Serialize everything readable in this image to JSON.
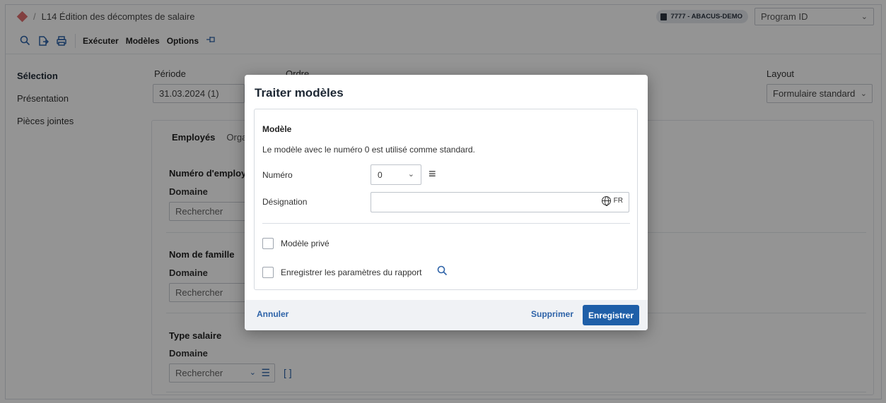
{
  "titlebar": {
    "breadcrumb_separator": "/",
    "title": "L14 Édition des décomptes de salaire",
    "environment": "7777 - ABACUS-DEMO",
    "program_select": "Program ID"
  },
  "toolbar": {
    "execute_label": "Exécuter",
    "models_label": "Modèles",
    "options_label": "Options"
  },
  "nav": {
    "items": [
      {
        "label": "Sélection"
      },
      {
        "label": "Présentation"
      },
      {
        "label": "Pièces jointes"
      }
    ]
  },
  "form": {
    "period_label": "Période",
    "period_value": "31.03.2024 (1)",
    "order_label": "Ordre",
    "layout_label": "Layout",
    "layout_value": "Formulaire standard",
    "tabs": [
      {
        "label": "Employés"
      },
      {
        "label": "Organi"
      }
    ],
    "sections": [
      {
        "title": "Numéro d'employé",
        "sub": "Domaine",
        "search": "Rechercher"
      },
      {
        "title": "Nom de famille",
        "sub": "Domaine",
        "search": "Rechercher"
      },
      {
        "title": "Type salaire",
        "sub": "Domaine",
        "search": "Rechercher"
      }
    ]
  },
  "modal": {
    "title": "Traiter modèles",
    "card_title": "Modèle",
    "note": "Le modèle avec le numéro 0 est utilisé comme standard.",
    "number_label": "Numéro",
    "number_value": "0",
    "designation_label": "Désignation",
    "designation_value": "",
    "language": "FR",
    "private_label": "Modèle privé",
    "save_params_label": "Enregistrer les paramètres du rapport",
    "cancel_label": "Annuler",
    "delete_label": "Supprimer",
    "save_label": "Enregistrer"
  },
  "colors": {
    "accent": "#1f5fa8",
    "link": "#2e63a8",
    "overlay": "rgba(0,0,0,0.42)"
  }
}
